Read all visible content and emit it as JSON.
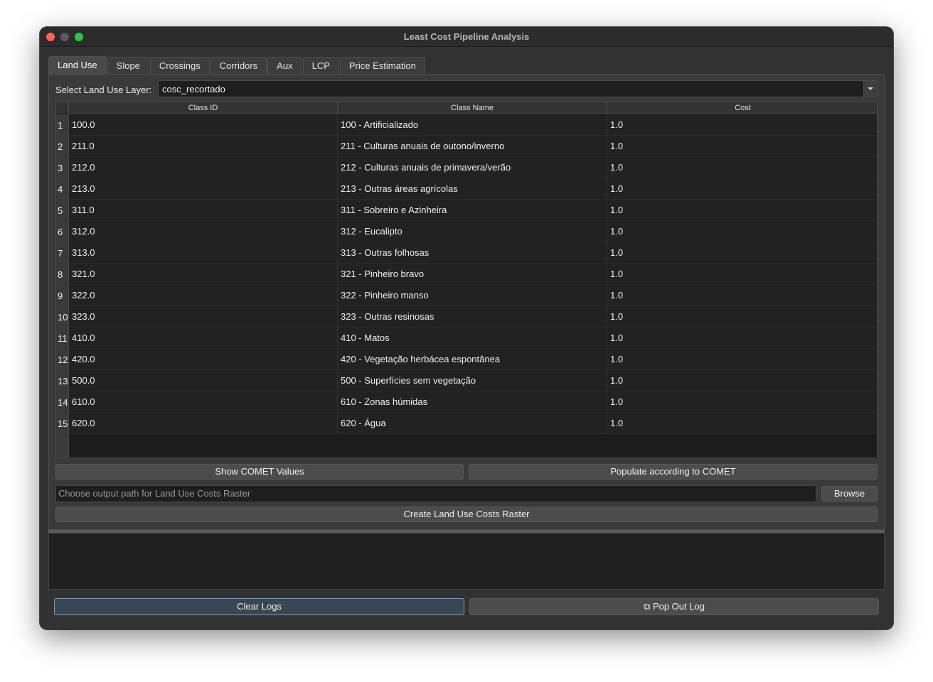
{
  "window": {
    "title": "Least Cost Pipeline Analysis"
  },
  "tabs": [
    {
      "label": "Land Use",
      "active": true
    },
    {
      "label": "Slope"
    },
    {
      "label": "Crossings"
    },
    {
      "label": "Corridors"
    },
    {
      "label": "Aux"
    },
    {
      "label": "LCP"
    },
    {
      "label": "Price Estimation"
    }
  ],
  "land_use": {
    "select_label": "Select Land Use Layer:",
    "selected_layer": "cosc_recortado",
    "columns": [
      "Class ID",
      "Class Name",
      "Cost"
    ],
    "rows": [
      {
        "n": "1",
        "id": "100.0",
        "name": "100 - Artificializado",
        "cost": "1.0"
      },
      {
        "n": "2",
        "id": "211.0",
        "name": "211 - Culturas anuais de outono/inverno",
        "cost": "1.0"
      },
      {
        "n": "3",
        "id": "212.0",
        "name": "212 - Culturas anuais de primavera/verão",
        "cost": "1.0"
      },
      {
        "n": "4",
        "id": "213.0",
        "name": "213 - Outras áreas agrícolas",
        "cost": "1.0"
      },
      {
        "n": "5",
        "id": "311.0",
        "name": "311 - Sobreiro e Azinheira",
        "cost": "1.0"
      },
      {
        "n": "6",
        "id": "312.0",
        "name": "312 - Eucalipto",
        "cost": "1.0"
      },
      {
        "n": "7",
        "id": "313.0",
        "name": "313 - Outras folhosas",
        "cost": "1.0"
      },
      {
        "n": "8",
        "id": "321.0",
        "name": "321 - Pinheiro bravo",
        "cost": "1.0"
      },
      {
        "n": "9",
        "id": "322.0",
        "name": "322 - Pinheiro manso",
        "cost": "1.0"
      },
      {
        "n": "10",
        "id": "323.0",
        "name": "323 - Outras resinosas",
        "cost": "1.0"
      },
      {
        "n": "11",
        "id": "410.0",
        "name": "410 - Matos",
        "cost": "1.0"
      },
      {
        "n": "12",
        "id": "420.0",
        "name": "420 - Vegetação herbácea espontânea",
        "cost": "1.0"
      },
      {
        "n": "13",
        "id": "500.0",
        "name": "500 - Superfícies sem vegetação",
        "cost": "1.0"
      },
      {
        "n": "14",
        "id": "610.0",
        "name": "610 - Zonas húmidas",
        "cost": "1.0"
      },
      {
        "n": "15",
        "id": "620.0",
        "name": "620 - Água",
        "cost": "1.0"
      }
    ],
    "show_comet_label": "Show COMET Values",
    "populate_comet_label": "Populate according to COMET",
    "output_placeholder": "Choose output path for Land Use Costs Raster",
    "browse_label": "Browse",
    "create_label": "Create Land Use Costs Raster"
  },
  "log": {
    "clear_label": "Clear Logs",
    "popout_label": "⧉ Pop Out Log"
  }
}
